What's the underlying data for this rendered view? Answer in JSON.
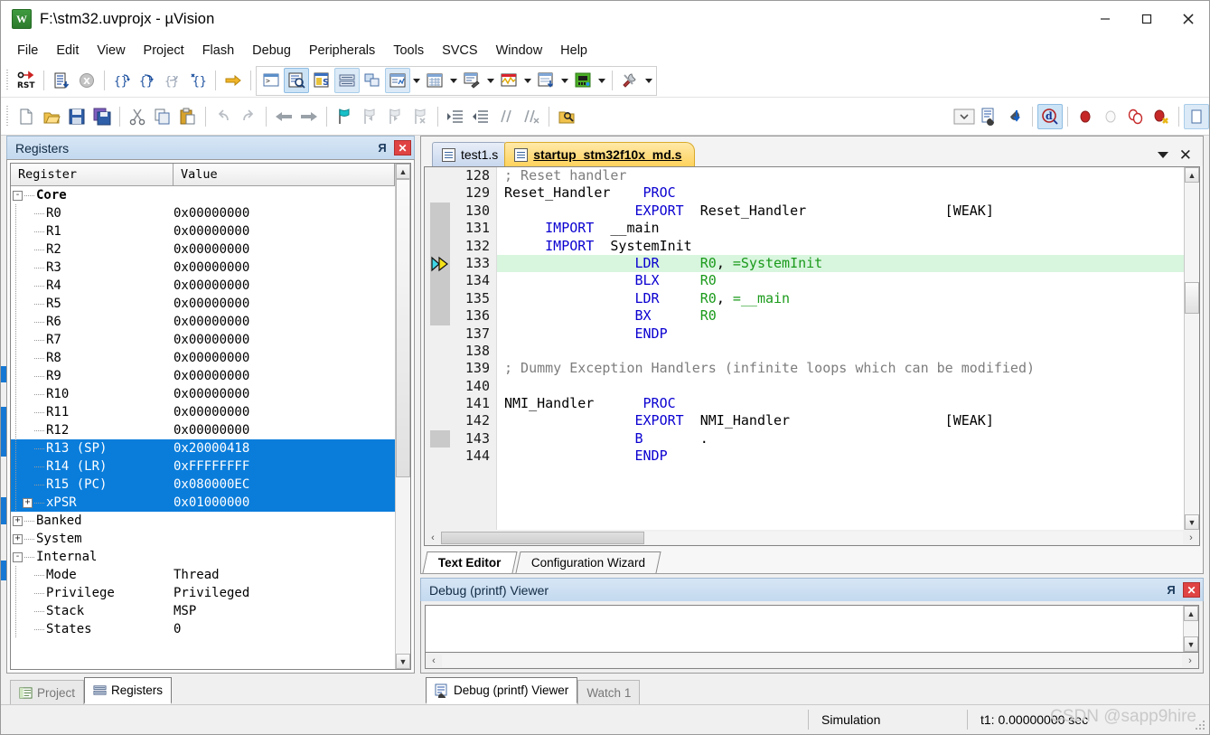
{
  "window": {
    "title": "F:\\stm32.uvprojx - µVision",
    "app_icon": "uvision-logo-icon",
    "minimize_label": "—",
    "maximize_label": "□",
    "close_label": "✕"
  },
  "menubar": {
    "items": [
      {
        "label": "File",
        "name": "menu-file"
      },
      {
        "label": "Edit",
        "name": "menu-edit"
      },
      {
        "label": "View",
        "name": "menu-view"
      },
      {
        "label": "Project",
        "name": "menu-project"
      },
      {
        "label": "Flash",
        "name": "menu-flash"
      },
      {
        "label": "Debug",
        "name": "menu-debug"
      },
      {
        "label": "Peripherals",
        "name": "menu-peripherals"
      },
      {
        "label": "Tools",
        "name": "menu-tools"
      },
      {
        "label": "SVCS",
        "name": "menu-svcs"
      },
      {
        "label": "Window",
        "name": "menu-window"
      },
      {
        "label": "Help",
        "name": "menu-help"
      }
    ]
  },
  "toolbar_debug": {
    "reset_label": "RST",
    "buttons": [
      "reset-cpu-icon",
      "run-icon",
      "stop-icon",
      "step-icon",
      "step-over-icon",
      "step-out-icon",
      "run-to-cursor-icon",
      "show-next-statement-icon",
      "command-window-icon",
      "disassembly-window-icon",
      "symbols-window-icon",
      "registers-window-icon",
      "call-stack-window-icon",
      "watch-window-icon",
      "memory-window-icon",
      "serial-window-icon",
      "analysis-window-icon",
      "trace-window-icon",
      "system-viewer-icon",
      "toolbox-icon"
    ]
  },
  "toolbar_file": {
    "buttons": [
      "new-file-icon",
      "open-file-icon",
      "save-icon",
      "save-all-icon",
      "cut-icon",
      "copy-icon",
      "paste-icon",
      "undo-icon",
      "redo-icon",
      "navigate-back-icon",
      "navigate-forward-icon",
      "bookmark-toggle-icon",
      "bookmark-prev-icon",
      "bookmark-next-icon",
      "bookmark-clear-icon",
      "indent-icon",
      "outdent-icon",
      "comment-icon",
      "uncomment-icon",
      "find-in-files-icon",
      "target-selector-icon",
      "target-options-icon",
      "batch-build-icon",
      "debug-session-icon",
      "insert-breakpoint-icon",
      "disable-breakpoint-icon",
      "disable-all-breakpoints-icon",
      "kill-all-breakpoints-icon"
    ]
  },
  "registers_pane": {
    "title": "Registers",
    "pin_icon": "pin-icon",
    "close_icon": "close-icon",
    "columns": [
      "Register",
      "Value"
    ],
    "rows": [
      {
        "name": "Core",
        "value": "",
        "depth": 0,
        "expander": "-",
        "bold": true,
        "selected": false
      },
      {
        "name": "R0",
        "value": "0x00000000",
        "depth": 1,
        "expander": "",
        "bold": false,
        "selected": false
      },
      {
        "name": "R1",
        "value": "0x00000000",
        "depth": 1,
        "expander": "",
        "bold": false,
        "selected": false
      },
      {
        "name": "R2",
        "value": "0x00000000",
        "depth": 1,
        "expander": "",
        "bold": false,
        "selected": false
      },
      {
        "name": "R3",
        "value": "0x00000000",
        "depth": 1,
        "expander": "",
        "bold": false,
        "selected": false
      },
      {
        "name": "R4",
        "value": "0x00000000",
        "depth": 1,
        "expander": "",
        "bold": false,
        "selected": false
      },
      {
        "name": "R5",
        "value": "0x00000000",
        "depth": 1,
        "expander": "",
        "bold": false,
        "selected": false
      },
      {
        "name": "R6",
        "value": "0x00000000",
        "depth": 1,
        "expander": "",
        "bold": false,
        "selected": false
      },
      {
        "name": "R7",
        "value": "0x00000000",
        "depth": 1,
        "expander": "",
        "bold": false,
        "selected": false
      },
      {
        "name": "R8",
        "value": "0x00000000",
        "depth": 1,
        "expander": "",
        "bold": false,
        "selected": false
      },
      {
        "name": "R9",
        "value": "0x00000000",
        "depth": 1,
        "expander": "",
        "bold": false,
        "selected": false
      },
      {
        "name": "R10",
        "value": "0x00000000",
        "depth": 1,
        "expander": "",
        "bold": false,
        "selected": false
      },
      {
        "name": "R11",
        "value": "0x00000000",
        "depth": 1,
        "expander": "",
        "bold": false,
        "selected": false
      },
      {
        "name": "R12",
        "value": "0x00000000",
        "depth": 1,
        "expander": "",
        "bold": false,
        "selected": false
      },
      {
        "name": "R13 (SP)",
        "value": "0x20000418",
        "depth": 1,
        "expander": "",
        "bold": false,
        "selected": true
      },
      {
        "name": "R14 (LR)",
        "value": "0xFFFFFFFF",
        "depth": 1,
        "expander": "",
        "bold": false,
        "selected": true
      },
      {
        "name": "R15 (PC)",
        "value": "0x080000EC",
        "depth": 1,
        "expander": "",
        "bold": false,
        "selected": true
      },
      {
        "name": "xPSR",
        "value": "0x01000000",
        "depth": 1,
        "expander": "+",
        "bold": false,
        "selected": true
      },
      {
        "name": "Banked",
        "value": "",
        "depth": 0,
        "expander": "+",
        "bold": false,
        "selected": false
      },
      {
        "name": "System",
        "value": "",
        "depth": 0,
        "expander": "+",
        "bold": false,
        "selected": false
      },
      {
        "name": "Internal",
        "value": "",
        "depth": 0,
        "expander": "-",
        "bold": false,
        "selected": false
      },
      {
        "name": "Mode",
        "value": "Thread",
        "depth": 1,
        "expander": "",
        "bold": false,
        "selected": false
      },
      {
        "name": "Privilege",
        "value": "Privileged",
        "depth": 1,
        "expander": "",
        "bold": false,
        "selected": false
      },
      {
        "name": "Stack",
        "value": "MSP",
        "depth": 1,
        "expander": "",
        "bold": false,
        "selected": false
      },
      {
        "name": "States",
        "value": "0",
        "depth": 1,
        "expander": "",
        "bold": false,
        "selected": false
      }
    ],
    "scroll_up": "▲",
    "scroll_down": "▼"
  },
  "left_dock_tabs": [
    {
      "label": "Project",
      "icon": "project-icon",
      "active": false
    },
    {
      "label": "Registers",
      "icon": "registers-icon",
      "active": true
    }
  ],
  "editor": {
    "tabs": [
      {
        "label": "test1.s",
        "icon": "asm-file-icon",
        "active": false
      },
      {
        "label": "startup_stm32f10x_md.s",
        "icon": "asm-file-icon",
        "active": true
      }
    ],
    "tab_menu_icon": "chevron-down-icon",
    "tab_close_icon": "close-icon",
    "current_line": 133,
    "first_line": 128,
    "lines": [
      {
        "n": "128",
        "tokens": [
          {
            "t": "; Reset handler",
            "c": "c-comment"
          }
        ]
      },
      {
        "n": "129",
        "tokens": [
          {
            "t": "Reset_Handler",
            "c": "c-plain"
          },
          {
            "t": "    ",
            "c": "c-plain"
          },
          {
            "t": "PROC",
            "c": "c-kw"
          }
        ]
      },
      {
        "n": "130",
        "tokens": [
          {
            "t": "                ",
            "c": "c-plain"
          },
          {
            "t": "EXPORT",
            "c": "c-kw"
          },
          {
            "t": "  Reset_Handler                 [WEAK]",
            "c": "c-plain"
          }
        ]
      },
      {
        "n": "131",
        "tokens": [
          {
            "t": "     ",
            "c": "c-plain"
          },
          {
            "t": "IMPORT",
            "c": "c-kw"
          },
          {
            "t": "  __main",
            "c": "c-plain"
          }
        ]
      },
      {
        "n": "132",
        "tokens": [
          {
            "t": "     ",
            "c": "c-plain"
          },
          {
            "t": "IMPORT",
            "c": "c-kw"
          },
          {
            "t": "  SystemInit",
            "c": "c-plain"
          }
        ]
      },
      {
        "n": "133",
        "hl": true,
        "tokens": [
          {
            "t": "                ",
            "c": "c-plain"
          },
          {
            "t": "LDR",
            "c": "c-kw"
          },
          {
            "t": "     ",
            "c": "c-plain"
          },
          {
            "t": "R0",
            "c": "c-reg"
          },
          {
            "t": ", ",
            "c": "c-plain"
          },
          {
            "t": "=SystemInit",
            "c": "c-reg"
          }
        ]
      },
      {
        "n": "134",
        "tokens": [
          {
            "t": "                ",
            "c": "c-plain"
          },
          {
            "t": "BLX",
            "c": "c-kw"
          },
          {
            "t": "     ",
            "c": "c-plain"
          },
          {
            "t": "R0",
            "c": "c-reg"
          }
        ]
      },
      {
        "n": "135",
        "tokens": [
          {
            "t": "                ",
            "c": "c-plain"
          },
          {
            "t": "LDR",
            "c": "c-kw"
          },
          {
            "t": "     ",
            "c": "c-plain"
          },
          {
            "t": "R0",
            "c": "c-reg"
          },
          {
            "t": ", ",
            "c": "c-plain"
          },
          {
            "t": "=__main",
            "c": "c-reg"
          }
        ]
      },
      {
        "n": "136",
        "tokens": [
          {
            "t": "                ",
            "c": "c-plain"
          },
          {
            "t": "BX",
            "c": "c-kw"
          },
          {
            "t": "      ",
            "c": "c-plain"
          },
          {
            "t": "R0",
            "c": "c-reg"
          }
        ]
      },
      {
        "n": "137",
        "tokens": [
          {
            "t": "                ",
            "c": "c-plain"
          },
          {
            "t": "ENDP",
            "c": "c-kw"
          }
        ]
      },
      {
        "n": "138",
        "tokens": []
      },
      {
        "n": "139",
        "tokens": [
          {
            "t": "; Dummy Exception Handlers (infinite loops which can be modified)",
            "c": "c-comment"
          }
        ]
      },
      {
        "n": "140",
        "tokens": []
      },
      {
        "n": "141",
        "tokens": [
          {
            "t": "NMI_Handler",
            "c": "c-plain"
          },
          {
            "t": "      ",
            "c": "c-plain"
          },
          {
            "t": "PROC",
            "c": "c-kw"
          }
        ]
      },
      {
        "n": "142",
        "tokens": [
          {
            "t": "                ",
            "c": "c-plain"
          },
          {
            "t": "EXPORT",
            "c": "c-kw"
          },
          {
            "t": "  NMI_Handler                   [WEAK]",
            "c": "c-plain"
          }
        ]
      },
      {
        "n": "143",
        "tokens": [
          {
            "t": "                ",
            "c": "c-plain"
          },
          {
            "t": "B",
            "c": "c-kw"
          },
          {
            "t": "       .",
            "c": "c-plain"
          }
        ]
      },
      {
        "n": "144",
        "tokens": [
          {
            "t": "                ",
            "c": "c-plain"
          },
          {
            "t": "ENDP",
            "c": "c-kw"
          }
        ]
      }
    ],
    "bottom_tabs": [
      {
        "label": "Text Editor",
        "active": true
      },
      {
        "label": "Configuration Wizard",
        "active": false
      }
    ]
  },
  "debug_viewer": {
    "title": "Debug (printf) Viewer",
    "pin_icon": "pin-icon",
    "close_icon": "close-icon",
    "content": ""
  },
  "bottom_dock_tabs": [
    {
      "label": "Debug (printf) Viewer",
      "icon": "debug-printf-icon",
      "active": true
    },
    {
      "label": "Watch 1",
      "icon": "",
      "active": false
    }
  ],
  "statusbar": {
    "target": "Simulation",
    "time": "t1: 0.00000000 sec",
    "watermark": "CSDN @sapp9hire"
  },
  "colors": {
    "selection_blue": "#0a7ddb",
    "active_tab_yellow": "#ffd25c",
    "inactive_tab_blue": "#c8d7ee",
    "highlight_green": "#d8f5de",
    "keyword_blue": "#0a00d0",
    "register_green": "#1a9a1a",
    "comment_gray": "#7d7d7d",
    "pane_header": "#c3d9ef",
    "close_red": "#e04343"
  }
}
